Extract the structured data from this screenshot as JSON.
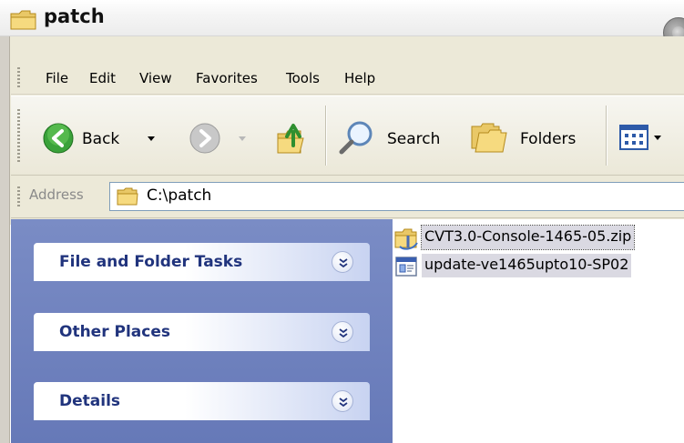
{
  "window": {
    "title": "patch"
  },
  "menubar": {
    "items": [
      "File",
      "Edit",
      "View",
      "Favorites",
      "Tools",
      "Help"
    ]
  },
  "toolbar": {
    "back_label": "Back",
    "search_label": "Search",
    "folders_label": "Folders"
  },
  "address": {
    "label": "Address",
    "value": "C:\\patch"
  },
  "taskpane": {
    "groups": [
      {
        "title": "File and Folder Tasks"
      },
      {
        "title": "Other Places"
      },
      {
        "title": "Details"
      }
    ]
  },
  "files": [
    {
      "name": "CVT3.0-Console-1465-05.zip",
      "icon": "zip-folder-icon",
      "selected": true
    },
    {
      "name": "update-ve1465upto10-SP02",
      "icon": "executable-icon",
      "selected": true
    }
  ],
  "colors": {
    "taskpane_bg": "#7a8cc5",
    "task_title": "#21347d",
    "chrome": "#ece9d8",
    "selection": "#dad9e2"
  }
}
